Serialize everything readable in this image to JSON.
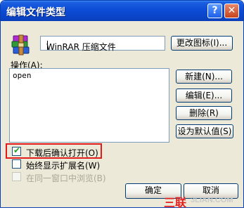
{
  "window": {
    "title": "编辑文件类型",
    "help_btn": "?",
    "close_btn": "✕"
  },
  "file_type": {
    "value": "WinRAR 压缩文件",
    "change_icon_label": "更改图标(I)..."
  },
  "operations": {
    "label": "操作(A):",
    "items": [
      "open"
    ],
    "buttons": {
      "new": "新建(N)...",
      "edit": "编辑(E)...",
      "delete": "删除(R)",
      "default": "设为默认值(S)"
    }
  },
  "checkboxes": [
    {
      "label": "下载后确认打开(O)",
      "checked": true,
      "disabled": false
    },
    {
      "label": "始终显示扩展名(W)",
      "checked": false,
      "disabled": false
    },
    {
      "label": "在同一窗口中浏览(B)",
      "checked": false,
      "disabled": true
    }
  ],
  "footer": {
    "ok": "确定",
    "cancel": "取消"
  },
  "watermark": {
    "text": "三联",
    "url": "3LIAN.COM"
  },
  "colors": {
    "titlebar": "#0a44c8",
    "highlight": "#e21b1b",
    "checkmark": "#21a121",
    "face": "#ece9d8"
  }
}
